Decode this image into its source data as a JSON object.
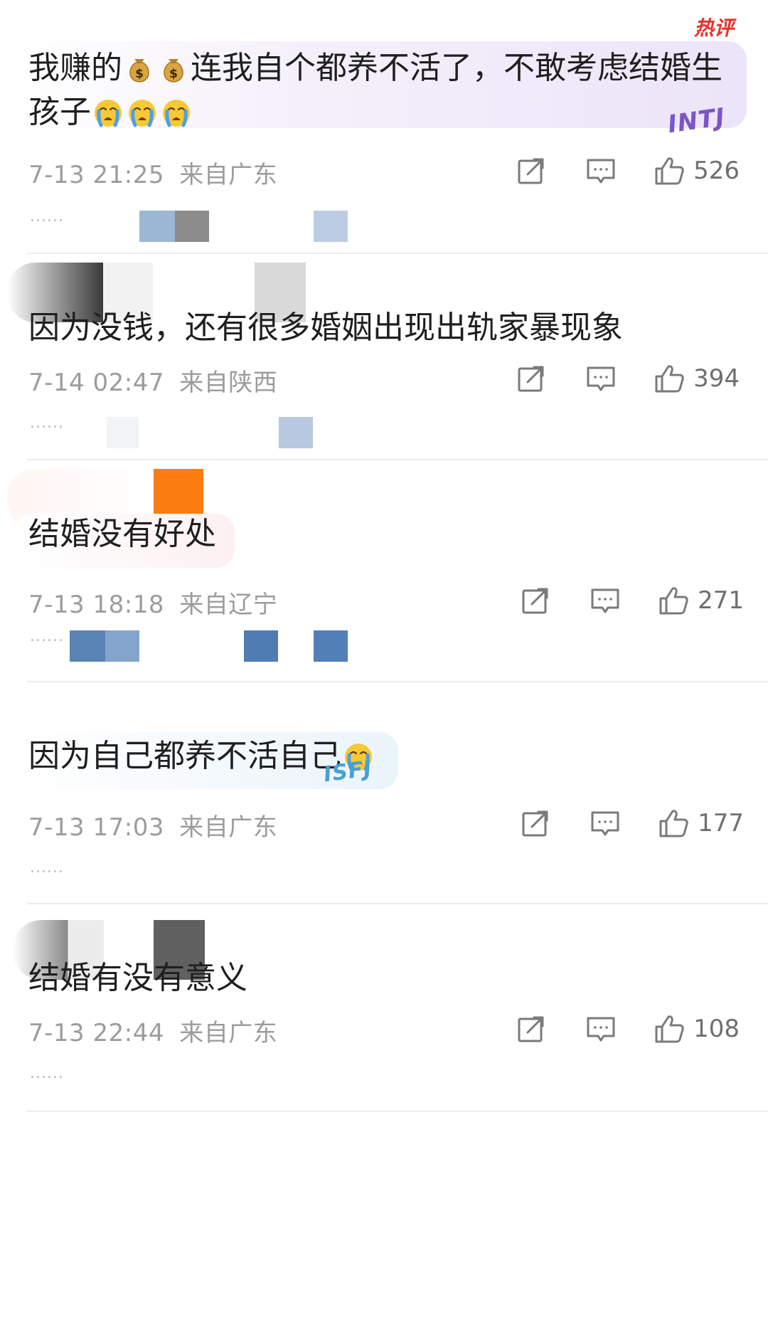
{
  "hot_badge": "热评",
  "comments": [
    {
      "text_a": "我赚的",
      "text_b": "连我自个都养不活了，不敢考虑结婚生",
      "text_c": "孩子",
      "time": "7-13 21:25",
      "location": "来自广东",
      "likes": "526",
      "badge": "INTJ"
    },
    {
      "text": "因为没钱，还有很多婚姻出现出轨家暴现象",
      "time": "7-14 02:47",
      "location": "来自陕西",
      "likes": "394"
    },
    {
      "text": "结婚没有好处",
      "time": "7-13 18:18",
      "location": "来自辽宁",
      "likes": "271"
    },
    {
      "text": "因为自己都养不活自己",
      "time": "7-13 17:03",
      "location": "来自广东",
      "likes": "177",
      "badge": "ISFJ"
    },
    {
      "text": "结婚有没有意义",
      "time": "7-13 22:44",
      "location": "来自广东",
      "likes": "108"
    }
  ],
  "reply_dots": "......",
  "icons": {
    "share": "share-icon",
    "reply": "reply-icon",
    "like": "thumbs-up-icon",
    "money": "money-bag-icon",
    "cry": "crying-face-icon"
  },
  "colors": {
    "hot": "#e8312a",
    "meta": "#9c9c9c",
    "text": "#1f1f1f",
    "bubble_purple": "#f1ecfb",
    "bubble_blue": "#e9f3fb",
    "bubble_pink": "#fbf1f2"
  }
}
